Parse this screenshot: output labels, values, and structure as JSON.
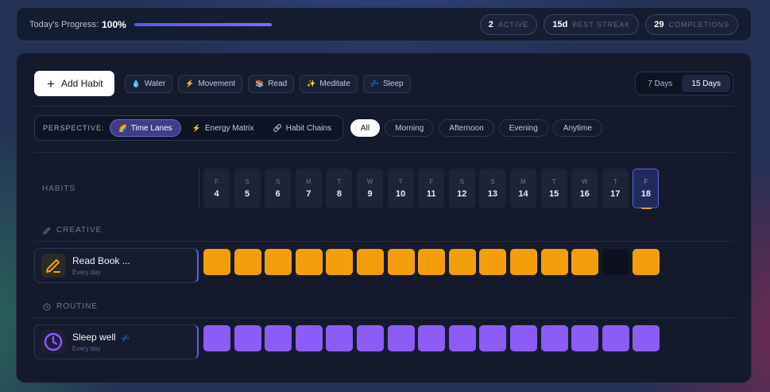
{
  "header": {
    "progress_label": "Today's Progress:",
    "progress_value": "100%",
    "progress_fraction": 1.0,
    "stats": [
      {
        "value": "2",
        "label": "ACTIVE"
      },
      {
        "value": "15d",
        "label": "BEST STREAK"
      },
      {
        "value": "29",
        "label": "COMPLETIONS"
      }
    ]
  },
  "toolbar": {
    "add_habit_label": "Add Habit",
    "quick_chips": [
      {
        "icon": "💧",
        "label": "Water"
      },
      {
        "icon": "⚡",
        "label": "Movement"
      },
      {
        "icon": "📚",
        "label": "Read"
      },
      {
        "icon": "✨",
        "label": "Meditate"
      },
      {
        "icon": "💤",
        "label": "Sleep"
      }
    ],
    "ranges": [
      "7 Days",
      "15 Days"
    ],
    "active_range": "15 Days"
  },
  "perspective": {
    "label": "PERSPECTIVE:",
    "options": [
      {
        "icon": "🌈",
        "label": "Time Lanes",
        "active": true
      },
      {
        "icon": "⚡",
        "label": "Energy Matrix",
        "active": false
      },
      {
        "icon": "🔗",
        "label": "Habit Chains",
        "active": false
      }
    ]
  },
  "time_of_day": {
    "options": [
      "All",
      "Morning",
      "Afternoon",
      "Evening",
      "Anytime"
    ],
    "active": "All"
  },
  "grid": {
    "habits_header": "HABITS",
    "days": [
      {
        "dow": "F",
        "num": "4"
      },
      {
        "dow": "S",
        "num": "5"
      },
      {
        "dow": "S",
        "num": "6"
      },
      {
        "dow": "M",
        "num": "7"
      },
      {
        "dow": "T",
        "num": "8"
      },
      {
        "dow": "W",
        "num": "9"
      },
      {
        "dow": "T",
        "num": "10"
      },
      {
        "dow": "F",
        "num": "11"
      },
      {
        "dow": "S",
        "num": "12"
      },
      {
        "dow": "S",
        "num": "13"
      },
      {
        "dow": "M",
        "num": "14"
      },
      {
        "dow": "T",
        "num": "15"
      },
      {
        "dow": "W",
        "num": "16"
      },
      {
        "dow": "T",
        "num": "17"
      },
      {
        "dow": "F",
        "num": "18"
      }
    ],
    "today_index": 14,
    "sections": [
      {
        "label": "CREATIVE",
        "icon": "pencil-icon",
        "habits": [
          {
            "name": "Read Book ...",
            "frequency": "Every day",
            "icon": "pencil-icon",
            "color": "#f59e0b",
            "completed": [
              true,
              true,
              true,
              true,
              true,
              true,
              true,
              true,
              true,
              true,
              true,
              true,
              true,
              false,
              true
            ]
          }
        ]
      },
      {
        "label": "ROUTINE",
        "icon": "clock-icon",
        "habits": [
          {
            "name": "Sleep well",
            "badge": "💤",
            "frequency": "Every day",
            "icon": "clock-icon",
            "color": "#8b5cf6",
            "completed": [
              true,
              true,
              true,
              true,
              true,
              true,
              true,
              true,
              true,
              true,
              true,
              true,
              true,
              true,
              true
            ]
          }
        ]
      }
    ]
  }
}
